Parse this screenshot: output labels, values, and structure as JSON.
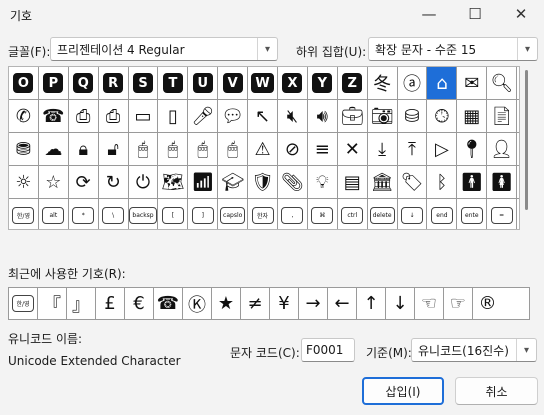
{
  "window": {
    "title": "기호",
    "minimize": "—",
    "maximize": "☐",
    "close": "✕"
  },
  "font_label": "글꼴(F):",
  "font_value": "프리젠테이션 4 Regular",
  "subset_label": "하위 집합(U):",
  "subset_value": "확장 문자 - 수준 15",
  "symbols": [
    [
      {
        "t": "O",
        "k": "dark"
      },
      {
        "t": "P",
        "k": "dark"
      },
      {
        "t": "Q",
        "k": "dark"
      },
      {
        "t": "R",
        "k": "dark"
      },
      {
        "t": "S",
        "k": "dark"
      },
      {
        "t": "T",
        "k": "dark"
      },
      {
        "t": "U",
        "k": "dark"
      },
      {
        "t": "V",
        "k": "dark"
      },
      {
        "t": "W",
        "k": "dark"
      },
      {
        "t": "X",
        "k": "dark"
      },
      {
        "t": "Y",
        "k": "dark"
      },
      {
        "t": "Z",
        "k": "dark"
      },
      {
        "t": "冬"
      },
      {
        "t": "ⓐ"
      },
      {
        "t": "⌂",
        "sel": true
      },
      {
        "t": "✉"
      },
      {
        "t": "🔍︎"
      }
    ],
    [
      {
        "t": "✆"
      },
      {
        "t": "☎"
      },
      {
        "t": "⎙"
      },
      {
        "t": "⎙"
      },
      {
        "t": "▭"
      },
      {
        "t": "▯"
      },
      {
        "t": "🎤︎"
      },
      {
        "t": "💬︎"
      },
      {
        "t": "↖"
      },
      {
        "t": "🔇︎"
      },
      {
        "t": "🔊︎"
      },
      {
        "t": "💼︎"
      },
      {
        "t": "📷︎"
      },
      {
        "t": "⛁"
      },
      {
        "t": "🕓︎"
      },
      {
        "t": "▦"
      },
      {
        "t": "📄︎"
      }
    ],
    [
      {
        "t": "⛃"
      },
      {
        "t": "☁"
      },
      {
        "t": "🔒︎"
      },
      {
        "t": "🔓︎"
      },
      {
        "t": "🖱︎"
      },
      {
        "t": "🖱︎"
      },
      {
        "t": "🖱︎"
      },
      {
        "t": "🖱︎"
      },
      {
        "t": "⚠"
      },
      {
        "t": "⊘"
      },
      {
        "t": "≡"
      },
      {
        "t": "✕"
      },
      {
        "t": "⤓"
      },
      {
        "t": "⤒"
      },
      {
        "t": "▷"
      },
      {
        "t": "📍︎"
      },
      {
        "t": "👤︎"
      }
    ],
    [
      {
        "t": "☼"
      },
      {
        "t": "☆"
      },
      {
        "t": "⟳"
      },
      {
        "t": "↻"
      },
      {
        "t": "⏻"
      },
      {
        "t": "🗺︎"
      },
      {
        "t": "📶︎"
      },
      {
        "t": "🎓︎"
      },
      {
        "t": "🛡︎"
      },
      {
        "t": "📎︎"
      },
      {
        "t": "💡︎"
      },
      {
        "t": "▤"
      },
      {
        "t": "🏛︎"
      },
      {
        "t": "🏷︎"
      },
      {
        "t": "ᛒ"
      },
      {
        "t": "🚹︎"
      },
      {
        "t": "🚺︎"
      }
    ],
    [
      {
        "t": "한/영",
        "k": "light"
      },
      {
        "t": "alt",
        "k": "light"
      },
      {
        "t": "*",
        "k": "light"
      },
      {
        "t": "\\",
        "k": "light"
      },
      {
        "t": "backsp",
        "k": "light"
      },
      {
        "t": "[",
        "k": "light"
      },
      {
        "t": "]",
        "k": "light"
      },
      {
        "t": "capslo",
        "k": "light"
      },
      {
        "t": "한자",
        "k": "light"
      },
      {
        "t": ",",
        "k": "light"
      },
      {
        "t": "⌘",
        "k": "light"
      },
      {
        "t": "ctrl",
        "k": "light"
      },
      {
        "t": "delete",
        "k": "light"
      },
      {
        "t": "↓",
        "k": "light"
      },
      {
        "t": "end",
        "k": "light"
      },
      {
        "t": "ente",
        "k": "light"
      },
      {
        "t": "=",
        "k": "light"
      }
    ]
  ],
  "recent_label": "최근에 사용한 기호(R):",
  "recent": [
    {
      "t": "한/영",
      "k": "light"
    },
    {
      "t": "『"
    },
    {
      "t": "』"
    },
    {
      "t": "£"
    },
    {
      "t": "€"
    },
    {
      "t": "☎"
    },
    {
      "t": "Ⓚ"
    },
    {
      "t": "★"
    },
    {
      "t": "≠"
    },
    {
      "t": "¥"
    },
    {
      "t": "→"
    },
    {
      "t": "←"
    },
    {
      "t": "↑"
    },
    {
      "t": "↓"
    },
    {
      "t": "☜"
    },
    {
      "t": "☞"
    },
    {
      "t": "®"
    }
  ],
  "unicode_name_label": "유니코드 이름:",
  "unicode_name_value": "Unicode Extended Character",
  "char_code_label": "문자 코드(C):",
  "char_code_value": "F0001",
  "from_label": "기준(M):",
  "from_value": "유니코드(16진수)",
  "insert_button": "삽입(I)",
  "cancel_button": "취소"
}
